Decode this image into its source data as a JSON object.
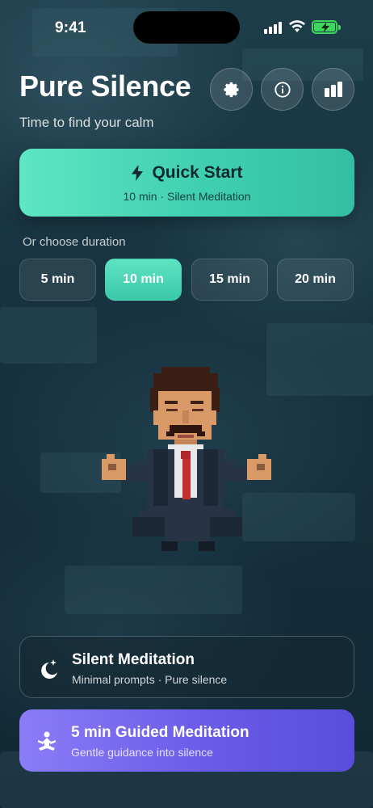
{
  "status_bar": {
    "time": "9:41"
  },
  "header": {
    "title": "Pure Silence",
    "subtitle": "Time to find your calm",
    "buttons": [
      {
        "icon": "gear-icon"
      },
      {
        "icon": "info-icon"
      },
      {
        "icon": "stats-icon"
      }
    ]
  },
  "quick_start": {
    "label": "Quick Start",
    "icon": "lightning-icon",
    "subtitle": "10 min · Silent Meditation"
  },
  "duration": {
    "label": "Or choose duration",
    "options": [
      "5 min",
      "10 min",
      "15 min",
      "20 min"
    ],
    "selected": "10 min"
  },
  "cards": {
    "silent": {
      "title": "Silent Meditation",
      "subtitle": "Minimal prompts · Pure silence",
      "icon": "moon-stars-icon"
    },
    "guided": {
      "title": "5 min Guided Meditation",
      "subtitle": "Gentle guidance into silence",
      "icon": "meditation-icon"
    }
  },
  "colors": {
    "accent": "#4dd8b8",
    "guided": "#6a5ce8",
    "battery": "#3ed65b"
  }
}
